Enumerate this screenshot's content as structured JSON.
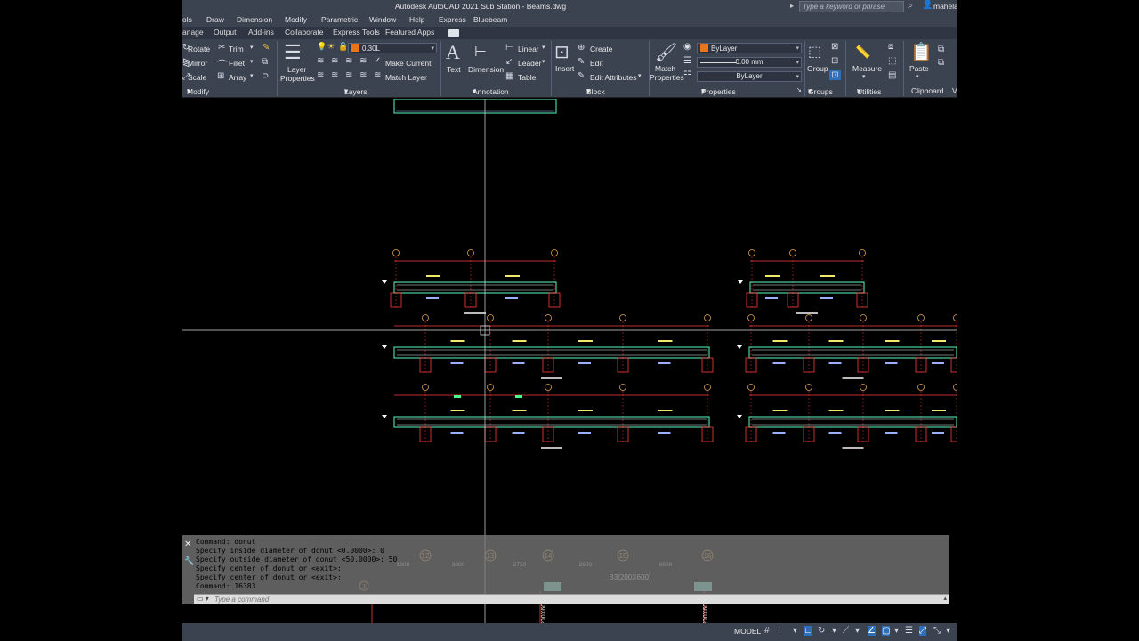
{
  "titlebar": {
    "title": "Autodesk AutoCAD 2021   Sub Station - Beams.dwg",
    "search_placeholder": "Type a keyword or phrase",
    "user": "mahela"
  },
  "menu": [
    "ols",
    "Draw",
    "Dimension",
    "Modify",
    "Parametric",
    "Window",
    "Help",
    "Express",
    "Bluebeam"
  ],
  "tabs": [
    "anage",
    "Output",
    "Add-ins",
    "Collaborate",
    "Express Tools",
    "Featured Apps"
  ],
  "ribbon": {
    "modify": {
      "rotate": "Rotate",
      "trim": "Trim",
      "mirror": "Mirror",
      "fillet": "Fillet",
      "scale": "Scale",
      "array": "Array",
      "panel": "Modify"
    },
    "layers": {
      "layer_properties_1": "Layer",
      "layer_properties_2": "Properties",
      "current_layer": "0.30L",
      "make_current": "Make Current",
      "match_layer": "Match Layer",
      "panel": "Layers"
    },
    "annotation": {
      "text": "Text",
      "dimension": "Dimension",
      "linear": "Linear",
      "leader": "Leader",
      "table": "Table",
      "panel": "Annotation"
    },
    "block": {
      "insert": "Insert",
      "create": "Create",
      "edit": "Edit",
      "edit_attributes": "Edit Attributes",
      "panel": "Block"
    },
    "properties": {
      "match_1": "Match",
      "match_2": "Properties",
      "color": "ByLayer",
      "lineweight": "0.00 mm",
      "linetype": "ByLayer",
      "panel": "Properties"
    },
    "groups": {
      "group": "Group",
      "panel": "Groups"
    },
    "utilities": {
      "measure": "Measure",
      "panel": "Utilities"
    },
    "clipboard": {
      "paste": "Paste",
      "panel": "Clipboard"
    },
    "view_cut": "V",
    "colors": {
      "layer_swatch": "#e8751a",
      "color_swatch": "#e8751a"
    }
  },
  "command": {
    "history": [
      "Command: donut",
      "Specify inside diameter of donut <0.0000>: 0",
      "Specify outside diameter of donut <50.0000>: 50",
      "Specify center of donut or <exit>:",
      "Specify center of donut or <exit>:",
      "Command: 16383"
    ],
    "placeholder": "Type a command"
  },
  "overlay": {
    "grid_labels": [
      "12",
      "13",
      "14",
      "15",
      "16"
    ],
    "dims": [
      "1800",
      "3800",
      "2750",
      "2600",
      "6600"
    ],
    "beam_label": "B3(200X600)",
    "left_marker": "J",
    "column_label_1": "200X600",
    "column_label_2": "200X600"
  },
  "statusbar": {
    "model": "MODEL"
  },
  "colors": {
    "ribbon_bg": "#3b4250",
    "beam_green": "#4bd2a0",
    "grid_red": "#ff3b3b",
    "bubble": "#e0a050",
    "text_yellow": "#f2e96b"
  }
}
